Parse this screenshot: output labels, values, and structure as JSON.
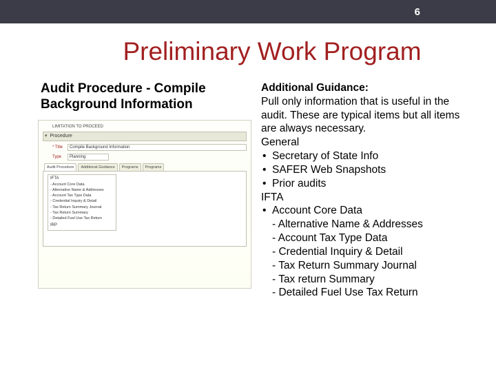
{
  "pageNumber": "6",
  "mainTitle": "Preliminary Work Program",
  "leftHeading": "Audit Procedure - Compile Background Information",
  "form": {
    "topCaption": "LIMITATION TO PROCEED",
    "procedureLabel": "Procedure",
    "titleLabel": "* Title",
    "titleValue": "Compile Background Information",
    "typeLabel": "Type",
    "typeValue": "Planning",
    "tabs": [
      "Audit Procedure",
      "Additional Guidance",
      "Programs",
      "Programs"
    ],
    "iftaHeader": "IFTA",
    "iftaItems": [
      "- Account Core Data",
      "- Alternative Name & Addresses",
      "- Account Tax Type Data",
      "- Credential Inquiry & Detail",
      "- Tax Return Summary Journal",
      "- Tax Return Summary",
      "- Detailed Fuel Use Tax Return"
    ],
    "irpHeader": "IRP"
  },
  "guidance": {
    "title": "Additional Guidance:",
    "body": "Pull only information that is useful in the audit. These are typical items but all items are always necessary.",
    "generalHeader": "General",
    "generalBullets": [
      "Secretary of State Info",
      "SAFER Web Snapshots",
      "Prior audits"
    ],
    "iftaHeader": "IFTA",
    "iftaBullet": "Account Core Data",
    "iftaSubs": [
      "- Alternative Name & Addresses",
      "- Account Tax Type Data",
      "- Credential Inquiry & Detail",
      "- Tax Return Summary Journal",
      "- Tax return Summary",
      "- Detailed Fuel Use Tax Return"
    ]
  }
}
